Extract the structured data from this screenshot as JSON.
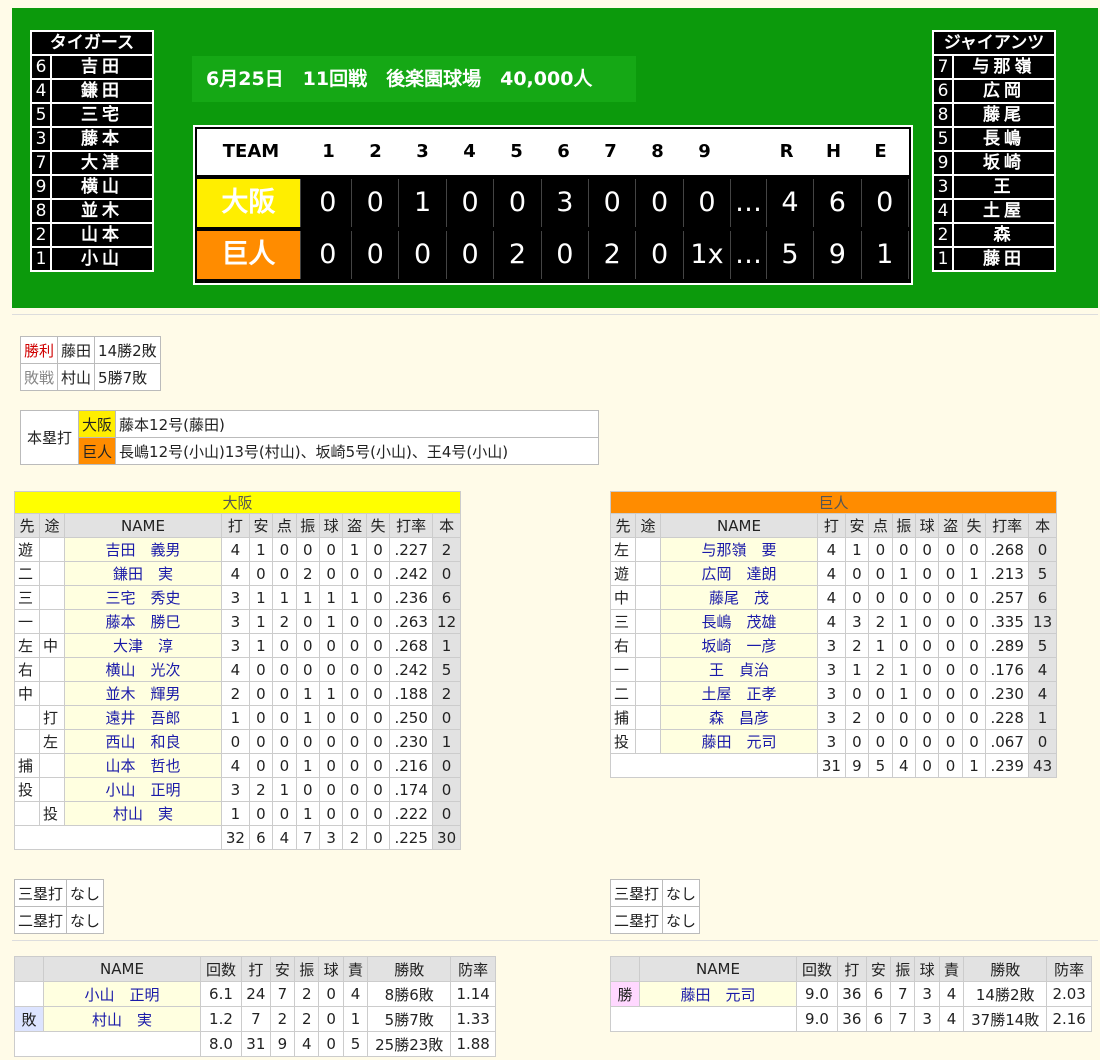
{
  "scoreboard": {
    "away_lineup": {
      "title": "タイガース",
      "rows": [
        {
          "pos": "6",
          "name": "吉田"
        },
        {
          "pos": "4",
          "name": "鎌田"
        },
        {
          "pos": "5",
          "name": "三宅"
        },
        {
          "pos": "3",
          "name": "藤本"
        },
        {
          "pos": "7",
          "name": "大津"
        },
        {
          "pos": "9",
          "name": "横山"
        },
        {
          "pos": "8",
          "name": "並木"
        },
        {
          "pos": "2",
          "name": "山本"
        },
        {
          "pos": "1",
          "name": "小山"
        }
      ]
    },
    "home_lineup": {
      "title": "ジャイアンツ",
      "rows": [
        {
          "pos": "7",
          "name": "与那嶺"
        },
        {
          "pos": "6",
          "name": "広岡"
        },
        {
          "pos": "8",
          "name": "藤尾"
        },
        {
          "pos": "5",
          "name": "長嶋"
        },
        {
          "pos": "9",
          "name": "坂崎"
        },
        {
          "pos": "3",
          "name": "王"
        },
        {
          "pos": "4",
          "name": "土屋"
        },
        {
          "pos": "2",
          "name": "森"
        },
        {
          "pos": "1",
          "name": "藤田"
        }
      ]
    },
    "game_info": "6月25日　11回戦　後楽園球場　40,000人",
    "header": [
      "TEAM",
      "1",
      "2",
      "3",
      "4",
      "5",
      "6",
      "7",
      "8",
      "9",
      "",
      "R",
      "H",
      "E"
    ],
    "away": {
      "team": "大阪",
      "color": "#ffee00",
      "innings": [
        "0",
        "0",
        "1",
        "0",
        "0",
        "3",
        "0",
        "0",
        "0"
      ],
      "dots": "…",
      "rhe": [
        "4",
        "6",
        "0"
      ]
    },
    "home": {
      "team": "巨人",
      "color": "#ff8c00",
      "innings": [
        "0",
        "0",
        "0",
        "0",
        "2",
        "0",
        "2",
        "0",
        "1x"
      ],
      "dots": "…",
      "rhe": [
        "5",
        "9",
        "1"
      ]
    }
  },
  "decisions": [
    {
      "label": "勝利",
      "color": "#d00000",
      "name": "藤田",
      "record": "14勝2敗"
    },
    {
      "label": "敗戦",
      "color": "#888888",
      "name": "村山",
      "record": "5勝7敗"
    }
  ],
  "homeruns": {
    "label": "本塁打",
    "rows": [
      {
        "team": "大阪",
        "color": "#ffee00",
        "text": "藤本12号(藤田)"
      },
      {
        "team": "巨人",
        "color": "#ff8c00",
        "text": "長嶋12号(小山)13号(村山)、坂崎5号(小山)、王4号(小山)"
      }
    ]
  },
  "batting_headers": [
    "先",
    "途",
    "NAME",
    "打",
    "安",
    "点",
    "振",
    "球",
    "盗",
    "失",
    "打率",
    "本"
  ],
  "away_batting": {
    "team": "大阪",
    "color": "#ffff00",
    "rows": [
      [
        "遊",
        "",
        "吉田　義男",
        "4",
        "1",
        "0",
        "0",
        "0",
        "1",
        "0",
        ".227",
        "2"
      ],
      [
        "二",
        "",
        "鎌田　実",
        "4",
        "0",
        "0",
        "2",
        "0",
        "0",
        "0",
        ".242",
        "0"
      ],
      [
        "三",
        "",
        "三宅　秀史",
        "3",
        "1",
        "1",
        "1",
        "1",
        "1",
        "0",
        ".236",
        "6"
      ],
      [
        "一",
        "",
        "藤本　勝巳",
        "3",
        "1",
        "2",
        "0",
        "1",
        "0",
        "0",
        ".263",
        "12"
      ],
      [
        "左",
        "中",
        "大津　淳",
        "3",
        "1",
        "0",
        "0",
        "0",
        "0",
        "0",
        ".268",
        "1"
      ],
      [
        "右",
        "",
        "横山　光次",
        "4",
        "0",
        "0",
        "0",
        "0",
        "0",
        "0",
        ".242",
        "5"
      ],
      [
        "中",
        "",
        "並木　輝男",
        "2",
        "0",
        "0",
        "1",
        "1",
        "0",
        "0",
        ".188",
        "2"
      ],
      [
        "",
        "打",
        "遠井　吾郎",
        "1",
        "0",
        "0",
        "1",
        "0",
        "0",
        "0",
        ".250",
        "0"
      ],
      [
        "",
        "左",
        "西山　和良",
        "0",
        "0",
        "0",
        "0",
        "0",
        "0",
        "0",
        ".230",
        "1"
      ],
      [
        "捕",
        "",
        "山本　哲也",
        "4",
        "0",
        "0",
        "1",
        "0",
        "0",
        "0",
        ".216",
        "0"
      ],
      [
        "投",
        "",
        "小山　正明",
        "3",
        "2",
        "1",
        "0",
        "0",
        "0",
        "0",
        ".174",
        "0"
      ],
      [
        "",
        "投",
        "村山　実",
        "1",
        "0",
        "0",
        "1",
        "0",
        "0",
        "0",
        ".222",
        "0"
      ]
    ],
    "totals": [
      "32",
      "6",
      "4",
      "7",
      "3",
      "2",
      "0",
      ".225",
      "30"
    ]
  },
  "home_batting": {
    "team": "巨人",
    "color": "#ff8c00",
    "rows": [
      [
        "左",
        "",
        "与那嶺　要",
        "4",
        "1",
        "0",
        "0",
        "0",
        "0",
        "0",
        ".268",
        "0"
      ],
      [
        "遊",
        "",
        "広岡　達朗",
        "4",
        "0",
        "0",
        "1",
        "0",
        "0",
        "1",
        ".213",
        "5"
      ],
      [
        "中",
        "",
        "藤尾　茂",
        "4",
        "0",
        "0",
        "0",
        "0",
        "0",
        "0",
        ".257",
        "6"
      ],
      [
        "三",
        "",
        "長嶋　茂雄",
        "4",
        "3",
        "2",
        "1",
        "0",
        "0",
        "0",
        ".335",
        "13"
      ],
      [
        "右",
        "",
        "坂崎　一彦",
        "3",
        "2",
        "1",
        "0",
        "0",
        "0",
        "0",
        ".289",
        "5"
      ],
      [
        "一",
        "",
        "王　貞治",
        "3",
        "1",
        "2",
        "1",
        "0",
        "0",
        "0",
        ".176",
        "4"
      ],
      [
        "二",
        "",
        "土屋　正孝",
        "3",
        "0",
        "0",
        "1",
        "0",
        "0",
        "0",
        ".230",
        "4"
      ],
      [
        "捕",
        "",
        "森　昌彦",
        "3",
        "2",
        "0",
        "0",
        "0",
        "0",
        "0",
        ".228",
        "1"
      ],
      [
        "投",
        "",
        "藤田　元司",
        "3",
        "0",
        "0",
        "0",
        "0",
        "0",
        "0",
        ".067",
        "0"
      ]
    ],
    "totals": [
      "31",
      "9",
      "5",
      "4",
      "0",
      "0",
      "1",
      ".239",
      "43"
    ]
  },
  "extra_hits": {
    "away": [
      {
        "label": "三塁打",
        "value": "なし"
      },
      {
        "label": "二塁打",
        "value": "なし"
      }
    ],
    "home": [
      {
        "label": "三塁打",
        "value": "なし"
      },
      {
        "label": "二塁打",
        "value": "なし"
      }
    ]
  },
  "pitching_headers": [
    "",
    "NAME",
    "回数",
    "打",
    "安",
    "振",
    "球",
    "責",
    "勝敗",
    "防率"
  ],
  "away_pitching": {
    "rows": [
      [
        "",
        "小山　正明",
        "6.1",
        "24",
        "7",
        "2",
        "0",
        "4",
        "8勝6敗",
        "1.14"
      ],
      [
        "敗",
        "村山　実",
        "1.2",
        "7",
        "2",
        "2",
        "0",
        "1",
        "5勝7敗",
        "1.33"
      ]
    ],
    "totals": [
      "8.0",
      "31",
      "9",
      "4",
      "0",
      "5",
      "25勝23敗",
      "1.88"
    ]
  },
  "home_pitching": {
    "rows": [
      [
        "勝",
        "藤田　元司",
        "9.0",
        "36",
        "6",
        "7",
        "3",
        "4",
        "14勝2敗",
        "2.03"
      ]
    ],
    "totals": [
      "9.0",
      "36",
      "6",
      "7",
      "3",
      "4",
      "37勝14敗",
      "2.16"
    ]
  }
}
